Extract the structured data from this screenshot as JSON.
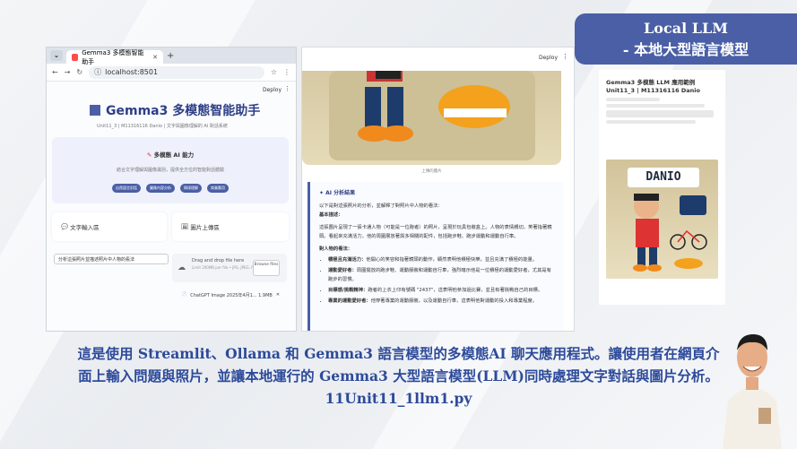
{
  "badge": {
    "line1": "Local LLM",
    "line2": "- 本地大型語言模型"
  },
  "browser": {
    "tab_title": "Gemma3 多模態智能助手",
    "url": "localhost:8501",
    "deploy": "Deploy"
  },
  "app": {
    "title": "Gemma3 多模態智能助手",
    "subtitle": "Unit11_3 | M11316116 Danio | 文字與圖像理解的 AI 對話系統",
    "card_heading": "多模態 AI 能力",
    "card_desc": "結合文字理解與圖像識別，提供全方位的智能對話體驗",
    "chips": [
      "自然語言對話",
      "圖像內容分析",
      "情境理解",
      "商業應用"
    ],
    "text_section": "文字輸入區",
    "image_section": "圖片上傳區",
    "text_value": "分析這張照片並描述照片中人物的看法",
    "drop_title": "Drag and drop file here",
    "drop_limit": "Limit 200MB per file • JPG, JPEG, PNG, WEBP",
    "browse": "Browse files",
    "file_name": "ChatGPT Image 2025年4月1... 1.9MB"
  },
  "result": {
    "deploy": "Deploy",
    "caption": "上傳的圖片",
    "heading": "AI 分析結果",
    "intro": "以下是對這張照片的分析，並解釋了對照片中人物的看法：",
    "basic_label": "基本描述：",
    "basic_text": "這張圖片呈現了一張卡通人物（可能是一位跑者）的照片，呈現於玩具包裝盒上。人物的表情親切，笑著指著鏡頭。看起來充滿活力，他的周圍展放著與多相關的配件，包括跑步鞋、跑步運動和運動自行車。",
    "view_label": "對人物的看法：",
    "points": [
      {
        "label": "積極且充滿活力：",
        "text": "他開心的笑容和指著鏡頭的動作，顯然表明他積極快樂，並且充滿了積極的能量。"
      },
      {
        "label": "運動愛好者：",
        "text": "周圍擺放的跑步鞋、運動服裝和運動自行車，強烈暗示他是一位積極的運動愛好者，尤其是有跑步的習慣。"
      },
      {
        "label": "目標感/挑戰精神：",
        "text": "跑者的上衣上印有號碼 \"2437\"，這表明他參加過比賽，並且有著挑戰自己的目標。"
      },
      {
        "label": "專業的運動愛好者：",
        "text": "他穿著專業的運動服裝，以及運動自行車，這表明他對運動的投入和專業程度。"
      }
    ]
  },
  "doc": {
    "title": "Gemma3 多模態 LLM 應用範例 Unit11_3 | M11316116 Danio",
    "danio": "DANIO"
  },
  "description": {
    "line1": "這是使用 Streamlit、Ollama 和 Gemma3 語言模型的多模態AI 聊天應用程式。讓使用者在網頁介",
    "line2": "面上輸入問題與照片，並讓本地運行的 Gemma3 大型語言模型(LLM)同時處理文字對話與圖片分析。",
    "line3": "11Unit11_1llm1.py"
  },
  "colors": {
    "accent": "#4a5fa6",
    "text_blue": "#2d4a9a"
  }
}
